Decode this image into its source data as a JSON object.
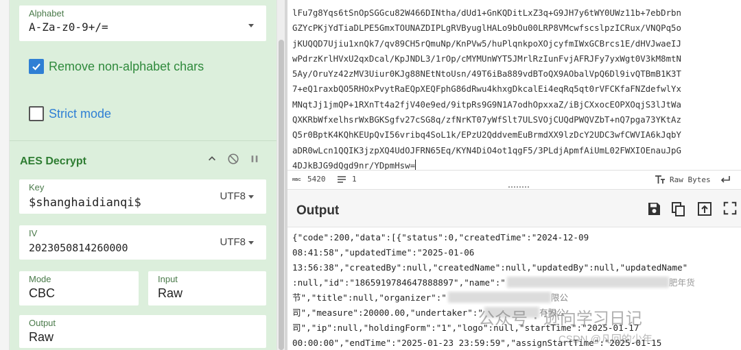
{
  "recipe": {
    "alphabet": {
      "label": "Alphabet",
      "value": "A-Za-z0-9+/="
    },
    "remove_non_alphabet": {
      "label": "Remove non-alphabet chars",
      "checked": true
    },
    "strict_mode": {
      "label": "Strict mode",
      "checked": false
    },
    "aes": {
      "title": "AES Decrypt",
      "key": {
        "label": "Key",
        "value": "$shanghaidianqi$",
        "encoding": "UTF8"
      },
      "iv": {
        "label": "IV",
        "value": "2023050814260000",
        "encoding": "UTF8"
      },
      "mode": {
        "label": "Mode",
        "value": "CBC"
      },
      "input": {
        "label": "Input",
        "value": "Raw"
      },
      "output": {
        "label": "Output",
        "value": "Raw"
      }
    }
  },
  "input": {
    "lines": [
      "lFu7g8Yqs6tSnOpSGGcu82W466DINtha/dUd1+GnKQDitLxZ3q+G9JH7y6tWY0UWz11b+7ebDrbn",
      "GZYcPKjYdTiaDLPE5GmxTOUNAZDIPLgRVByuglHALo9bOu00LRP8VMcwfscslpzICRux/VNQPq5o",
      "jKUQQD7Ujiu1xnQk7/qv89CH5rQmuNp/KnPVw5/huPlqnkpoXOjcyfmIWxGCBrcs1E/dHVJwaeIJ",
      "wPdrzKrlHVxU2qxDcal/KpJNDL3/1rOp/cMYMUnWYT5JMrlRzIunFvjAFRJFy7yxWgt0V3kM8mtN",
      "5Ay/OruYz42zMV3Uiur0KJg88NEtNtoUsn/49T6iBa889vdBToQX9AObalVpQ6Dl9ivQTBmB1K3T",
      "7+eQ1raxbQO5RHOxPvytRaEQpXEQFphG86dRwu4khxgDkcalEi4eqRq5qt0rVFCKfaFNZdefwlYx",
      "MNqtJj1jmQP+1RXnTt4a2fjV40e9ed/9itpRs9G9N1A7odhOpxxaZ/iBjCXxocEOPXOqjS3lJtWa",
      "QXKRbWfxelhsrWxBGKSgfv27cSG8q/zfNrKT07yWfSlt7ULSVOjCUQdPWQVZbT+nQ7pga73YKtAz",
      "Q5r0BptK4KQhKEUpQvI56vribq4SoL1k/EPzU2QddvemEuBrmdXX9lzDcY2UDC3wfCWVIA6kJqbY",
      "aDR0wLcn1QQIK3jzpXQ4UdOJFRN65Eq/KYN4DiO4ot1qgF5/3PLdjApmfAiUmL02FWXIOEnauJpG",
      "4DJkBJG9dQgd9nr/YDpmHsw="
    ],
    "status": {
      "length": "5420",
      "lines": "1",
      "raw_bytes": "Raw Bytes"
    }
  },
  "output": {
    "title": "Output",
    "lines": [
      "{\"code\":200,\"data\":[{\"status\":0,\"createdTime\":\"2024-12-09",
      "08:41:58\",\"updatedTime\":\"2025-01-06",
      "13:56:38\",\"createdBy\":null,\"createdName\":null,\"updatedBy\":null,\"updatedName\"",
      ":null,\"id\":\"1865919784647888897\",\"name\":\"",
      "节\",\"title\":null,\"organizer\":\"",
      "\",\"measure\":20000.00,\"undertaker\":\"",
      "\",\"ip\":null,\"holdingForm\":\"1\",\"logo\":null,\"startTime\":\"2025-01-17",
      "00:00:00\",\"endTime\":\"2025-01-23 23:59:59\",\"assignStartTime\":\"2025-01-15"
    ],
    "fragments": {
      "line4_tail": "肥年货",
      "line5_tail": "限公",
      "line6_prefix": "司",
      "line6_tail": "有限公",
      "line7_prefix": "司"
    }
  },
  "watermark": {
    "main": "公众号 · 逊向学习日记",
    "sub": "CSDN @凡回的少年"
  },
  "colors": {
    "recipe_bg": "#dcefdc",
    "accent_blue": "#2f7fd4",
    "accent_green": "#2e7d32"
  }
}
